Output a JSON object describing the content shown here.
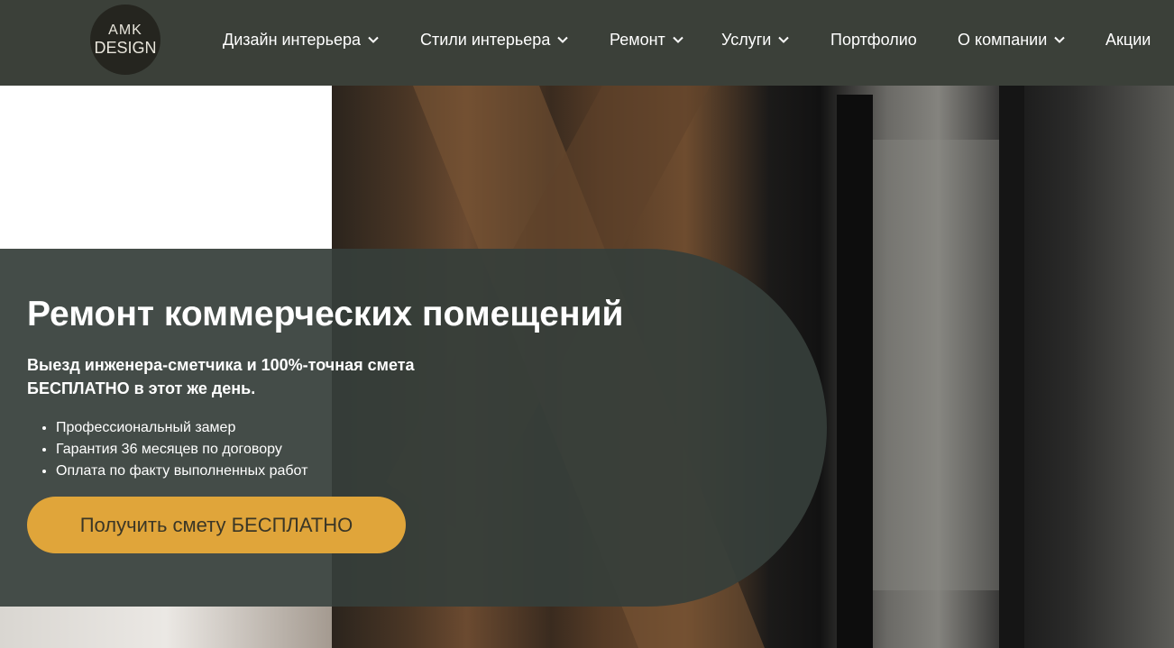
{
  "logo": {
    "line1": "AMK",
    "line2": "DESIGN"
  },
  "nav": {
    "items": [
      {
        "label": "Дизайн интерьера",
        "has_dropdown": true
      },
      {
        "label": "Стили интерьера",
        "has_dropdown": true
      },
      {
        "label": "Ремонт",
        "has_dropdown": true
      },
      {
        "label": "Услуги",
        "has_dropdown": true
      },
      {
        "label": "Портфолио",
        "has_dropdown": false
      },
      {
        "label": "О компании",
        "has_dropdown": true
      },
      {
        "label": "Акции",
        "has_dropdown": false
      }
    ]
  },
  "hero": {
    "title": "Ремонт коммерческих помещений",
    "subtitle_line1": "Выезд инженера-сметчика и 100%-точная смета",
    "subtitle_line2": "БЕСПЛАТНО в этот же день.",
    "bullets": [
      "Профессиональный замер",
      "Гарантия 36 месяцев по договору",
      "Оплата по факту выполненных работ"
    ],
    "cta_label": "Получить смету БЕСПЛАТНО"
  },
  "colors": {
    "header_bg": "#3b4039",
    "panel_bg": "#363e3a",
    "accent": "#e0a53a"
  }
}
